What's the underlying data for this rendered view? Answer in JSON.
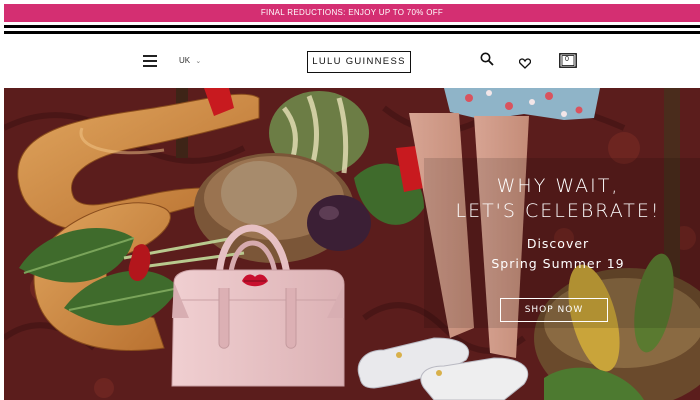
{
  "promo": {
    "text": "FINAL REDUCTIONS: ENJOY UP TO 70% OFF"
  },
  "header": {
    "region": "UK",
    "logo": "LULU GUINNESS",
    "bag_count": "0",
    "icons": [
      "menu-icon",
      "chevron-down-icon",
      "search-icon",
      "heart-icon",
      "bag-icon"
    ]
  },
  "hero": {
    "headline_line1": "WHY WAIT,",
    "headline_line2": "LET'S CELEBRATE!",
    "sub_line1": "Discover",
    "sub_line2": "Spring Summer 19",
    "cta": "SHOP NOW"
  },
  "colors": {
    "promo_bg": "#d42f72",
    "bag_pink": "#e8c2c4",
    "lip_red": "#c8102e"
  }
}
